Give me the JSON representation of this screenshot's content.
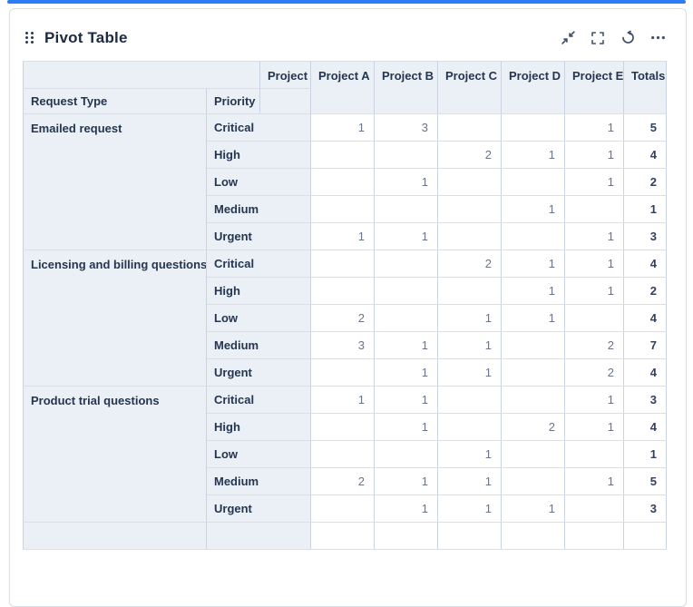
{
  "widget": {
    "title": "Pivot Table",
    "toolbar": [
      {
        "name": "minimize",
        "icon": "minimize-icon"
      },
      {
        "name": "fullscreen",
        "icon": "fullscreen-icon"
      },
      {
        "name": "refresh",
        "icon": "refresh-icon"
      },
      {
        "name": "more",
        "icon": "more-icon"
      }
    ],
    "accent_color": "#2e7cf5"
  },
  "table": {
    "col_dimension_label": "Project",
    "row_headers": {
      "request_type": "Request Type",
      "priority": "Priority"
    },
    "columns": [
      "Project A",
      "Project B",
      "Project C",
      "Project D",
      "Project E",
      "Totals"
    ],
    "groups": [
      {
        "request_type": "Emailed request",
        "rows": [
          {
            "priority": "Critical",
            "values": [
              "1",
              "3",
              "",
              "",
              "1"
            ],
            "total": "5"
          },
          {
            "priority": "High",
            "values": [
              "",
              "",
              "2",
              "1",
              "1"
            ],
            "total": "4"
          },
          {
            "priority": "Low",
            "values": [
              "",
              "1",
              "",
              "",
              "1"
            ],
            "total": "2"
          },
          {
            "priority": "Medium",
            "values": [
              "",
              "",
              "",
              "1",
              ""
            ],
            "total": "1"
          },
          {
            "priority": "Urgent",
            "values": [
              "1",
              "1",
              "",
              "",
              "1"
            ],
            "total": "3"
          }
        ]
      },
      {
        "request_type": "Licensing and billing questions",
        "rows": [
          {
            "priority": "Critical",
            "values": [
              "",
              "",
              "2",
              "1",
              "1"
            ],
            "total": "4"
          },
          {
            "priority": "High",
            "values": [
              "",
              "",
              "",
              "1",
              "1"
            ],
            "total": "2"
          },
          {
            "priority": "Low",
            "values": [
              "2",
              "",
              "1",
              "1",
              ""
            ],
            "total": "4"
          },
          {
            "priority": "Medium",
            "values": [
              "3",
              "1",
              "1",
              "",
              "2"
            ],
            "total": "7"
          },
          {
            "priority": "Urgent",
            "values": [
              "",
              "1",
              "1",
              "",
              "2"
            ],
            "total": "4"
          }
        ]
      },
      {
        "request_type": "Product trial questions",
        "rows": [
          {
            "priority": "Critical",
            "values": [
              "1",
              "1",
              "",
              "",
              "1"
            ],
            "total": "3"
          },
          {
            "priority": "High",
            "values": [
              "",
              "1",
              "",
              "2",
              "1"
            ],
            "total": "4"
          },
          {
            "priority": "Low",
            "values": [
              "",
              "",
              "1",
              "",
              ""
            ],
            "total": "1"
          },
          {
            "priority": "Medium",
            "values": [
              "2",
              "1",
              "1",
              "",
              "1"
            ],
            "total": "5"
          },
          {
            "priority": "Urgent",
            "values": [
              "",
              "1",
              "1",
              "1",
              ""
            ],
            "total": "3"
          }
        ]
      }
    ]
  }
}
